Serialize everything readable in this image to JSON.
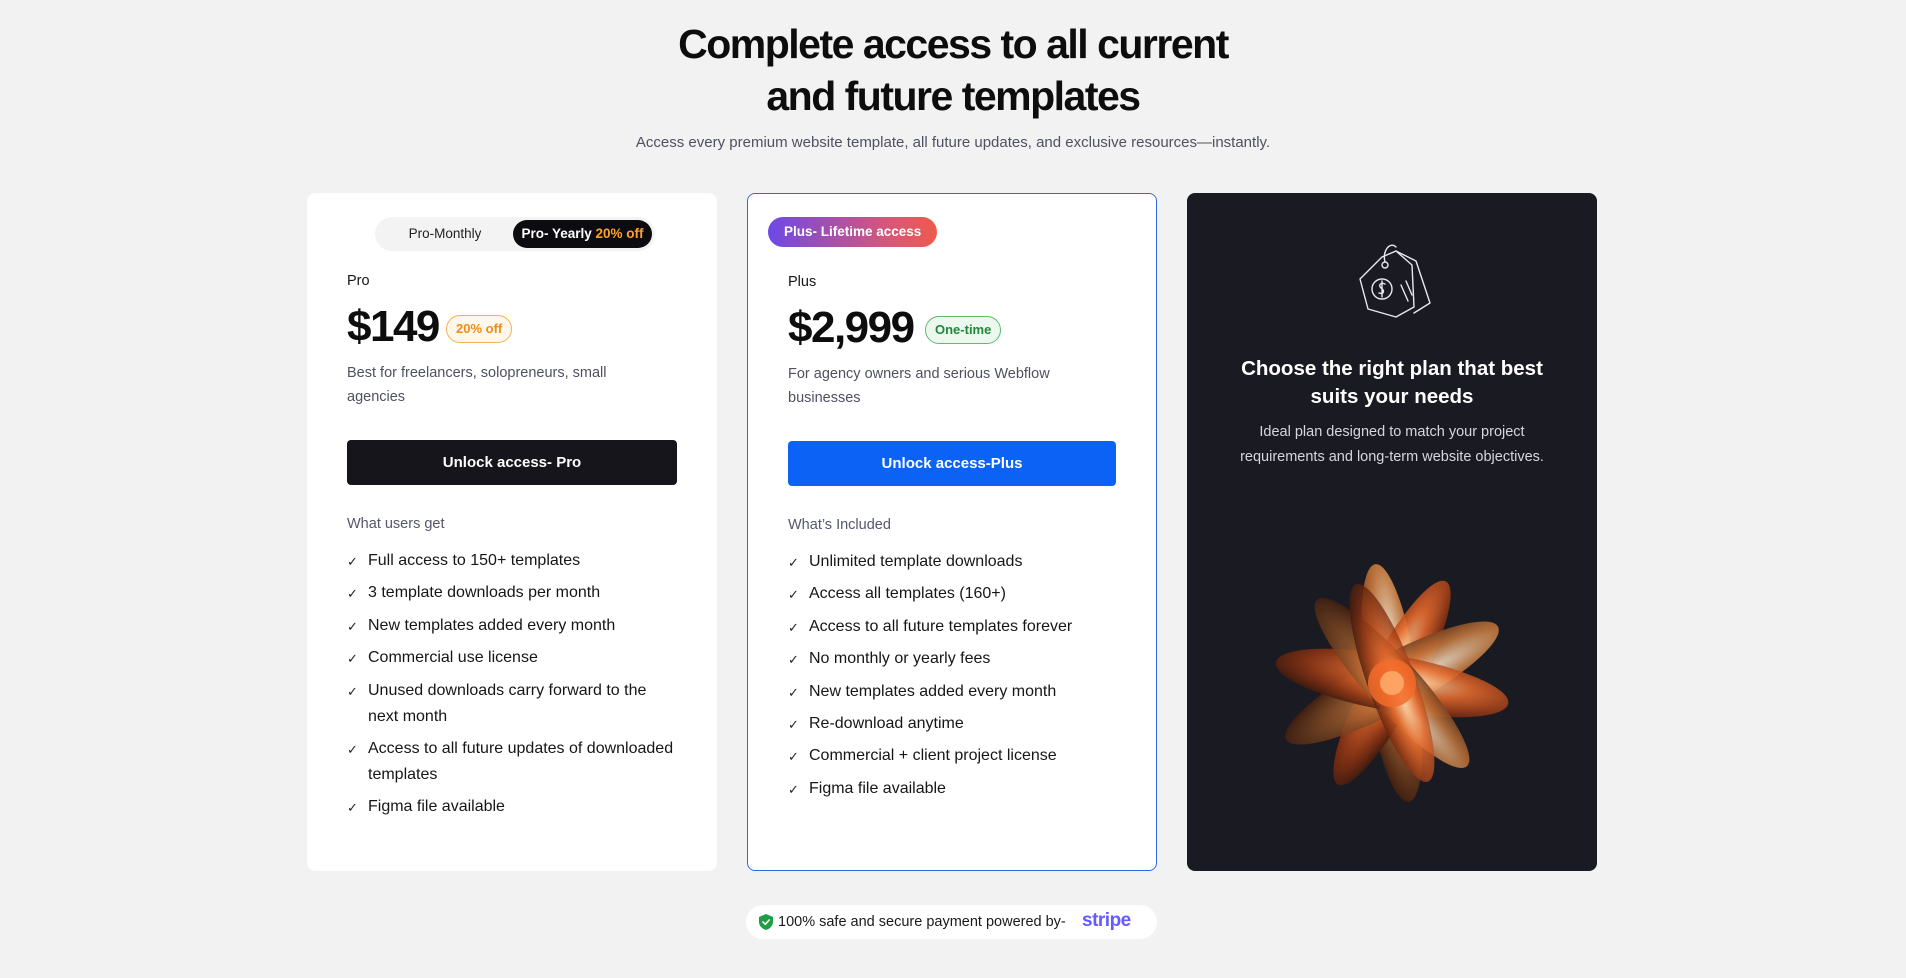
{
  "hero": {
    "title_line1": "Complete access to all current",
    "title_line2": "and future templates",
    "subtitle": "Access every premium website template, all future updates, and exclusive resources—instantly."
  },
  "pro": {
    "toggle_monthly": "Pro-Monthly",
    "toggle_yearly": "Pro- Yearly ",
    "toggle_yearly_discount": "20% off",
    "plan_name": "Pro",
    "price": "$149",
    "badge": "20% off",
    "description": "Best for freelancers, solopreneurs, small agencies",
    "cta": "Unlock access- Pro",
    "list_heading": "What users get",
    "features": [
      "Full access to 150+ templates",
      "3 template downloads per month",
      "New templates added every month",
      "Commercial use license",
      "Unused downloads carry forward to the next month",
      "Access to all future updates of downloaded templates",
      "Figma file available"
    ]
  },
  "plus": {
    "pill": "Plus- Lifetime access",
    "plan_name": "Plus",
    "price": "$2,999",
    "badge": "One-time",
    "description": "For agency owners and serious Webflow businesses",
    "cta": "Unlock access-Plus",
    "list_heading": "What’s Included",
    "features": [
      "Unlimited template downloads",
      "Access all templates (160+)",
      "Access to all future templates forever",
      "No monthly or yearly fees",
      "New templates added every month",
      "Re-download anytime",
      "Commercial + client project license",
      "Figma file available"
    ]
  },
  "info": {
    "icon": "price-tag-icon",
    "title": "Choose the right plan that best suits your needs",
    "description": "Ideal plan designed to match your project requirements and long-term website objectives."
  },
  "footer": {
    "icon": "shield-check-icon",
    "text": "100% safe and secure payment powered by-",
    "brand": "stripe"
  },
  "colors": {
    "accent_blue": "#0b62f5",
    "dark": "#15151b",
    "discount_orange": "#f08c14",
    "success_green": "#22873a",
    "stripe_purple": "#635bff"
  }
}
